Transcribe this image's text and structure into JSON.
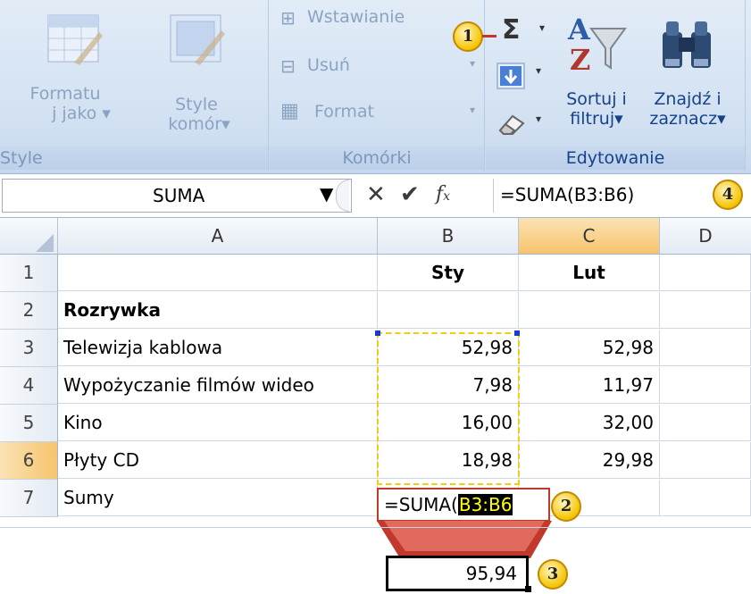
{
  "ribbon": {
    "style_group": {
      "format_as_table_line1": "Formatu",
      "format_as_table_line2": "j jako",
      "cell_styles_line1": "Style",
      "cell_styles_line2": "komór",
      "label": "Style"
    },
    "cells_group": {
      "insert": "Wstawianie",
      "delete": "Usuń",
      "format": "Format",
      "label": "Komórki"
    },
    "editing_group": {
      "sort_line1": "Sortuj i",
      "sort_line2": "filtruj",
      "find_line1": "Znajdź i",
      "find_line2": "zaznacz",
      "label": "Edytowanie"
    }
  },
  "formula_bar": {
    "name_box": "SUMA",
    "formula": "=SUMA(B3:B6)"
  },
  "grid": {
    "columns": [
      "A",
      "B",
      "C",
      "D"
    ],
    "rows": [
      {
        "num": "1",
        "a": "",
        "b": "Sty",
        "c": "Lut"
      },
      {
        "num": "2",
        "a": "Rozrywka",
        "b": "",
        "c": ""
      },
      {
        "num": "3",
        "a": "Telewizja kablowa",
        "b": "52,98",
        "c": "52,98"
      },
      {
        "num": "4",
        "a": "Wypożyczanie filmów wideo",
        "b": "7,98",
        "c": "11,97"
      },
      {
        "num": "5",
        "a": "Kino",
        "b": "16,00",
        "c": "32,00"
      },
      {
        "num": "6",
        "a": "Płyty CD",
        "b": "18,98",
        "c": "29,98"
      },
      {
        "num": "7",
        "a": "Sumy",
        "b": "",
        "c": ""
      }
    ],
    "edit_prefix": "=SUMA(",
    "edit_range": "B3:B6",
    "result": "95,94"
  },
  "callouts": [
    "1",
    "2",
    "3",
    "4"
  ],
  "colors": {
    "accent_orange": "#f7c46c",
    "callout_red": "#c0392b",
    "marching_ants": "#1a3ccc",
    "range_highlight": "#ffff00"
  }
}
